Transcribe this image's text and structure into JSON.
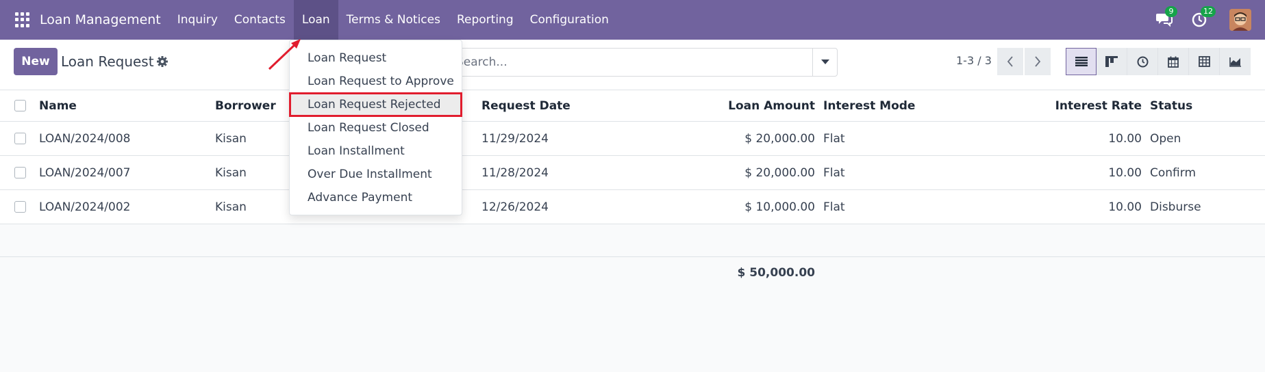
{
  "navbar": {
    "brand": "Loan Management",
    "menu": [
      {
        "label": "Inquiry"
      },
      {
        "label": "Contacts"
      },
      {
        "label": "Loan"
      },
      {
        "label": "Terms & Notices"
      },
      {
        "label": "Reporting"
      },
      {
        "label": "Configuration"
      }
    ],
    "messages_badge": "9",
    "activities_badge": "12",
    "accent": "#71639e"
  },
  "control": {
    "new_label": "New",
    "title": "Loan Request",
    "search_placeholder": "Search...",
    "pager": "1-3 / 3"
  },
  "table": {
    "columns": {
      "name": "Name",
      "borrower": "Borrower",
      "request_date": "Request Date",
      "loan_amount": "Loan Amount",
      "interest_mode": "Interest Mode",
      "interest_rate": "Interest Rate",
      "status": "Status"
    },
    "rows": [
      {
        "name": "LOAN/2024/008",
        "borrower": "Kisan",
        "request_date": "11/29/2024",
        "loan_amount": "$ 20,000.00",
        "interest_mode": "Flat",
        "interest_rate": "10.00",
        "status": "Open"
      },
      {
        "name": "LOAN/2024/007",
        "borrower": "Kisan",
        "request_date": "11/28/2024",
        "loan_amount": "$ 20,000.00",
        "interest_mode": "Flat",
        "interest_rate": "10.00",
        "status": "Confirm"
      },
      {
        "name": "LOAN/2024/002",
        "borrower": "Kisan",
        "request_date": "12/26/2024",
        "loan_amount": "$ 10,000.00",
        "interest_mode": "Flat",
        "interest_rate": "10.00",
        "status": "Disburse"
      }
    ],
    "total": "$ 50,000.00"
  },
  "dropdown": {
    "items": [
      {
        "label": "Loan Request"
      },
      {
        "label": "Loan Request to Approve"
      },
      {
        "label": "Loan Request Rejected"
      },
      {
        "label": "Loan Request Closed"
      },
      {
        "label": "Loan Installment"
      },
      {
        "label": "Over Due Installment"
      },
      {
        "label": "Advance Payment"
      }
    ],
    "highlight_color": "#e11d2e"
  }
}
